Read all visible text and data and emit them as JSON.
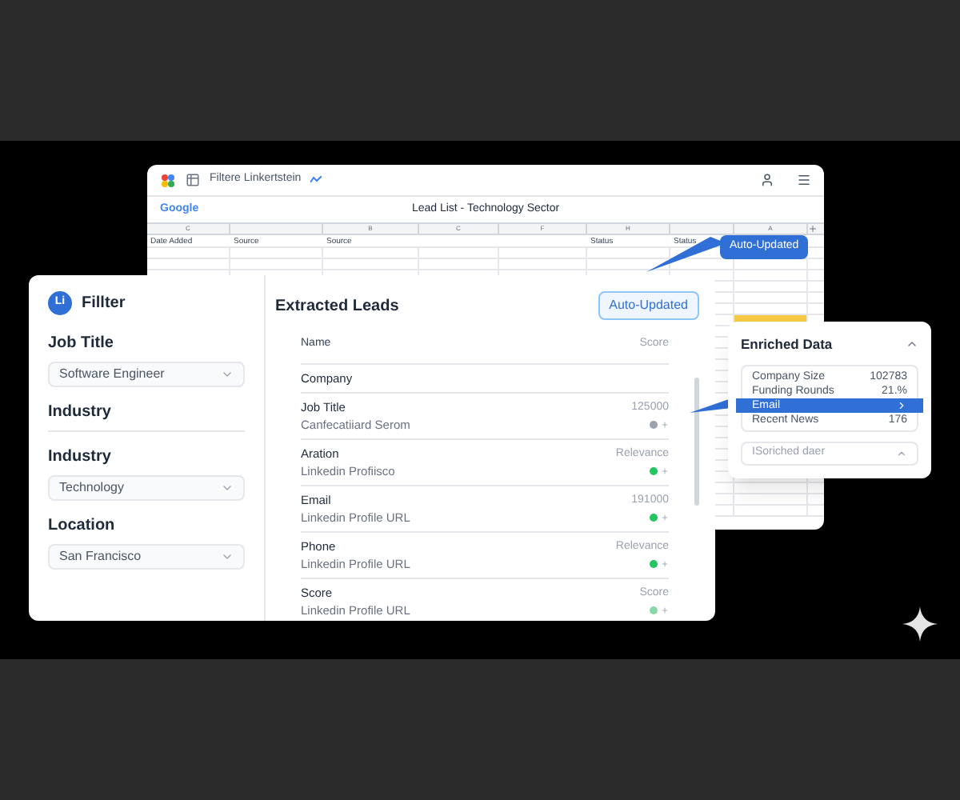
{
  "sheet_window": {
    "title": "Filtere Linkertstein",
    "brand": "Google",
    "sheet_title": "Lead List - Technology Sector",
    "columns": [
      {
        "letter": "C",
        "header": "Date Added"
      },
      {
        "header": "Source"
      },
      {
        "letter": "B",
        "header": "Source"
      },
      {
        "letter": "C"
      },
      {
        "letter": "F"
      },
      {
        "letter": "H",
        "header": "Status"
      },
      {
        "header": "Status"
      },
      {
        "letter": "A"
      }
    ],
    "callout": "Auto-Updated"
  },
  "filter_panel": {
    "logo": "Li",
    "title": "Fillter",
    "fields": [
      {
        "kind": "select",
        "label": "Job Title",
        "value": "Software Engineer"
      },
      {
        "kind": "heading",
        "label": "Industry"
      },
      {
        "kind": "select",
        "label": "Industry",
        "value": "Technology"
      },
      {
        "kind": "select",
        "label": "Location",
        "value": "San Francisco"
      }
    ]
  },
  "leads": {
    "title": "Extracted Leads",
    "badge": "Auto-Updated",
    "columns": [
      "Name",
      "Score"
    ],
    "rows": [
      {
        "title": "Company"
      },
      {
        "title": "Job Title",
        "subtitle": "Canfecatiiard Serom",
        "value": "125000",
        "color": "#9ca3af"
      },
      {
        "title": "Aration",
        "subtitle": "Linkedin Profiisco",
        "value": "Relevance",
        "color": "#22c55e"
      },
      {
        "title": "Email",
        "subtitle": "Linkedin Profile URL",
        "value": "191000",
        "color": "#22c55e"
      },
      {
        "title": "Phone",
        "subtitle": "Linkedin Profile URL",
        "value": "Relevance",
        "color": "#22c55e"
      },
      {
        "title": "Score",
        "subtitle": "Linkedin Profile URL",
        "value": "Score",
        "color": "#86d9a4"
      }
    ]
  },
  "enriched": {
    "title": "Enriched Data",
    "items": [
      {
        "label": "Company Size",
        "value": "102783",
        "selected": false
      },
      {
        "label": "Funding Rounds",
        "value": "21.%",
        "selected": false
      },
      {
        "label": "Email",
        "selected": true
      },
      {
        "label": "Recent News",
        "value": "176",
        "selected": false
      }
    ],
    "footer": "ISoriched daer"
  }
}
